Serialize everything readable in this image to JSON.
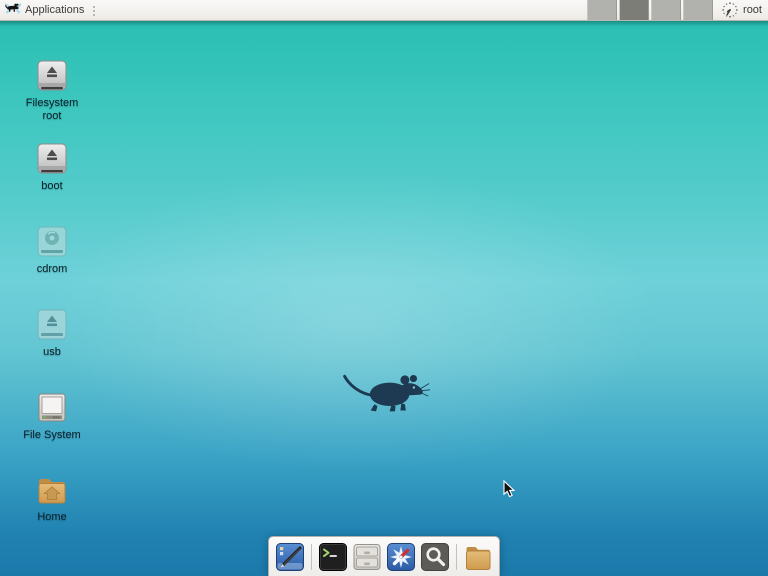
{
  "panel": {
    "applications_label": "Applications",
    "username": "root",
    "workspaces": {
      "count": 4,
      "active_index": 2
    },
    "clock_style": "analog-clock"
  },
  "desktop": {
    "icons": [
      {
        "label": "Filesystem root",
        "icon": "removable-drive-icon"
      },
      {
        "label": "boot",
        "icon": "removable-drive-icon"
      },
      {
        "label": "cdrom",
        "icon": "optical-disc-icon"
      },
      {
        "label": "usb",
        "icon": "removable-drive-ghost-icon"
      },
      {
        "label": "File System",
        "icon": "computer-icon"
      },
      {
        "label": "Home",
        "icon": "home-folder-icon"
      }
    ],
    "center_logo": "xfce-mouse-logo"
  },
  "dock": {
    "items": [
      {
        "title": "Show Desktop",
        "icon": "desktop-pen-icon"
      },
      {
        "title": "Terminal Emulator",
        "icon": "terminal-icon"
      },
      {
        "title": "File Manager",
        "icon": "drawer-cabinet-icon"
      },
      {
        "title": "Web Browser",
        "icon": "compass-icon"
      },
      {
        "title": "Application Finder",
        "icon": "magnifier-icon"
      },
      {
        "title": "Home Directory",
        "icon": "folder-icon"
      }
    ]
  },
  "colors": {
    "panel_bg": "#f3f1ee",
    "wallpaper_top": "#2cbfb3",
    "wallpaper_mid": "#6ed1d9",
    "wallpaper_bottom": "#1b79aa",
    "logo_silhouette": "#1d3a52",
    "folder_tan": "#d9a85f"
  }
}
